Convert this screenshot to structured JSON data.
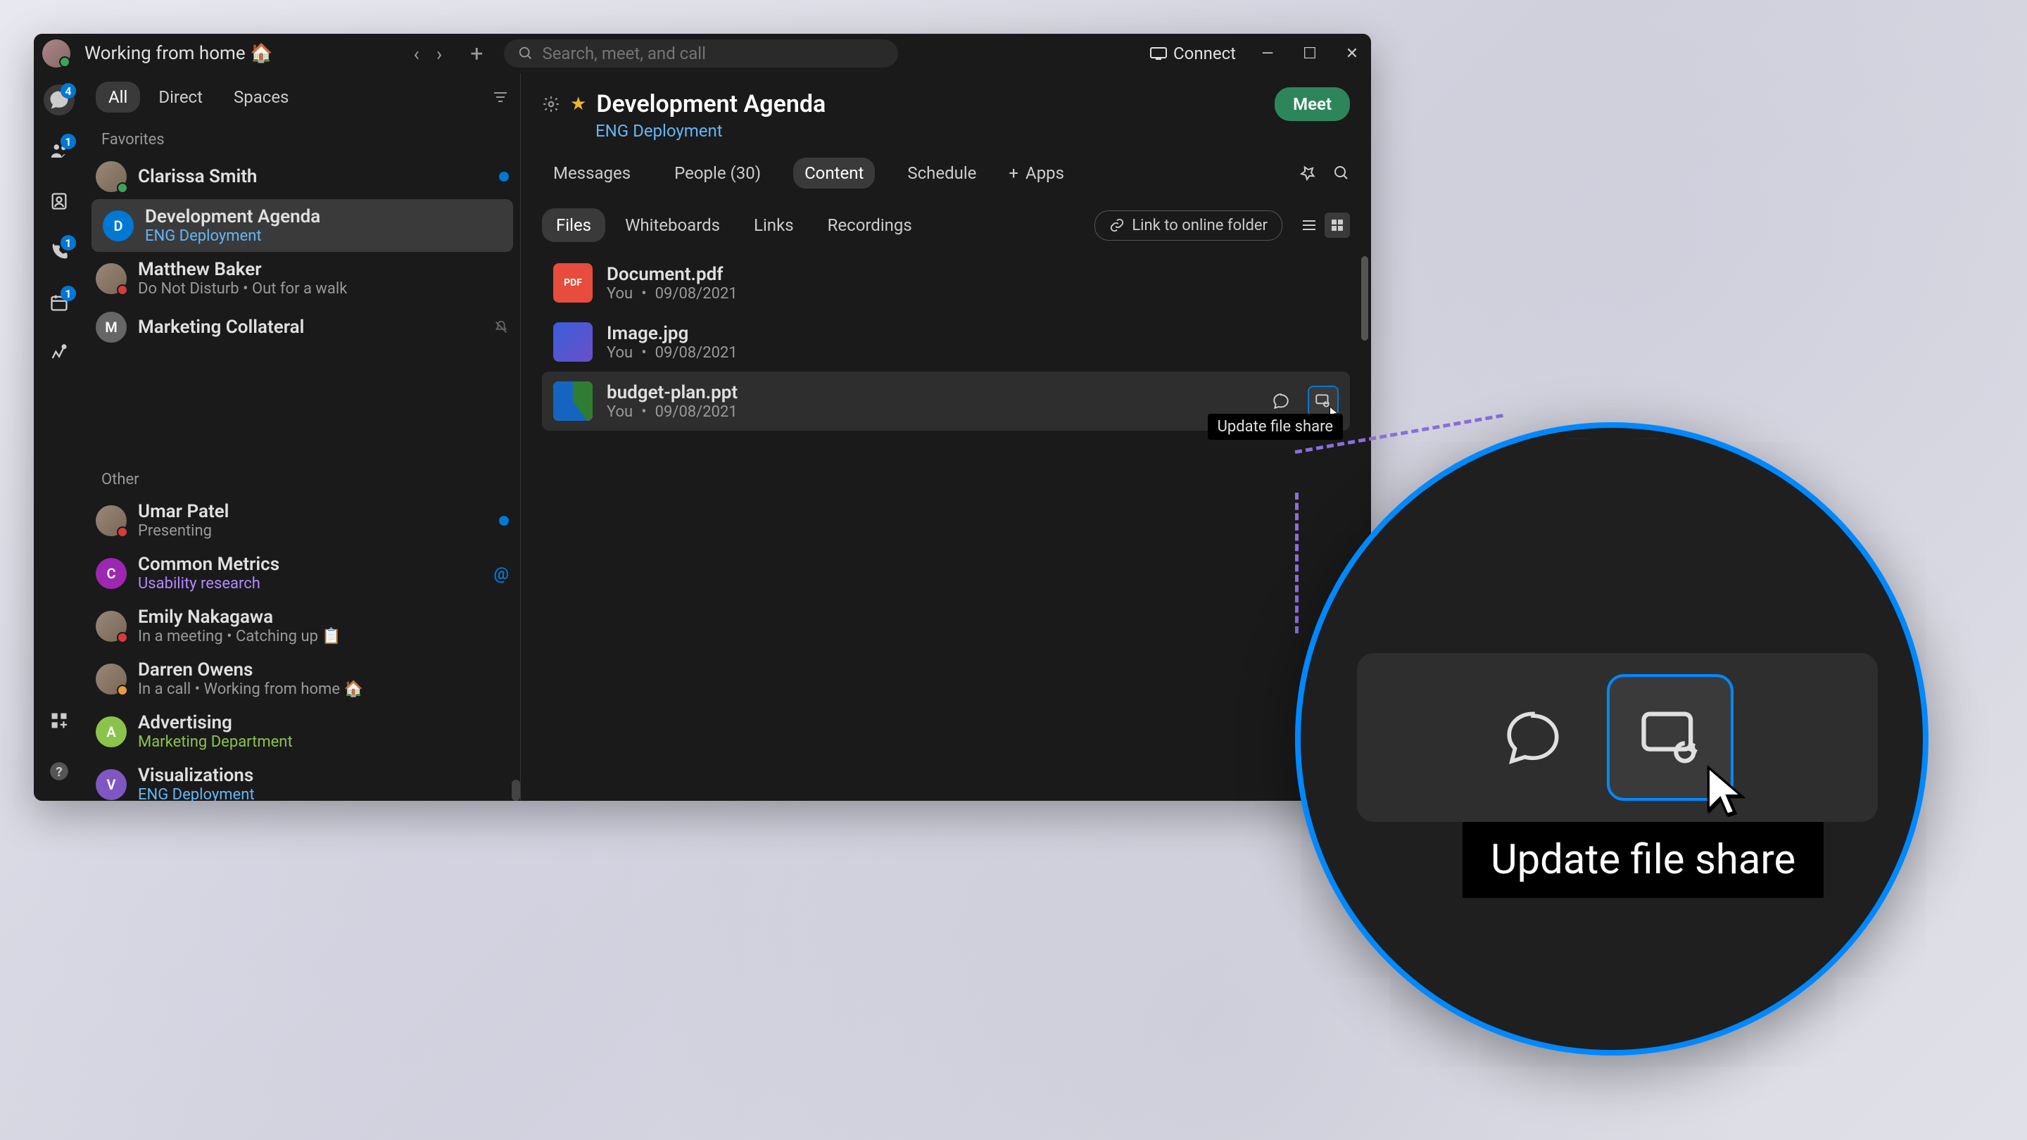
{
  "titlebar": {
    "status": "Working from home 🏠",
    "search_placeholder": "Search, meet, and call",
    "connect": "Connect"
  },
  "rail": {
    "chat_badge": "4",
    "teams_badge": "1",
    "calls_badge": "1",
    "calendar_badge": "1"
  },
  "sidebar": {
    "tabs": {
      "all": "All",
      "direct": "Direct",
      "spaces": "Spaces"
    },
    "favorites_label": "Favorites",
    "other_label": "Other",
    "favorites": [
      {
        "name": "Clarissa Smith",
        "sub": "",
        "avatar": "img",
        "unread": true,
        "presence": "green"
      },
      {
        "name": "Development Agenda",
        "sub": "ENG Deployment",
        "avatar": "D",
        "avatarColor": "#0078d4",
        "subClass": "blue",
        "selected": true
      },
      {
        "name": "Matthew Baker",
        "sub": "Do Not Disturb  •  Out for a walk",
        "avatar": "img",
        "presence": "red"
      },
      {
        "name": "Marketing Collateral",
        "sub": "",
        "avatar": "M",
        "avatarColor": "#666",
        "muted": true
      }
    ],
    "other": [
      {
        "name": "Umar Patel",
        "sub": "Presenting",
        "avatar": "img",
        "presence": "red",
        "unread": true
      },
      {
        "name": "Common Metrics",
        "sub": "Usability research",
        "avatar": "C",
        "avatarColor": "#9c27b0",
        "subClass": "purple",
        "mention": true
      },
      {
        "name": "Emily Nakagawa",
        "sub": "In a meeting  •  Catching up 📋",
        "avatar": "img",
        "presence": "red"
      },
      {
        "name": "Darren Owens",
        "sub": "In a call  •  Working from home 🏠",
        "avatar": "img",
        "presence": "orange"
      },
      {
        "name": "Advertising",
        "sub": "Marketing Department",
        "avatar": "A",
        "avatarColor": "#8bc34a",
        "subClass": "green"
      },
      {
        "name": "Visualizations",
        "sub": "ENG Deployment",
        "avatar": "V",
        "avatarColor": "#7e57c2",
        "subClass": "blue"
      }
    ]
  },
  "content": {
    "title": "Development Agenda",
    "subtitle": "ENG Deployment",
    "meet": "Meet",
    "tabs": {
      "messages": "Messages",
      "people": "People (30)",
      "content": "Content",
      "schedule": "Schedule",
      "apps": "Apps"
    },
    "subtabs": {
      "files": "Files",
      "whiteboards": "Whiteboards",
      "links": "Links",
      "recordings": "Recordings"
    },
    "link_folder": "Link to online folder",
    "files": [
      {
        "name": "Document.pdf",
        "author": "You",
        "date": "09/08/2021",
        "type": "pdf"
      },
      {
        "name": "Image.jpg",
        "author": "You",
        "date": "09/08/2021",
        "type": "img"
      },
      {
        "name": "budget-plan.ppt",
        "author": "You",
        "date": "09/08/2021",
        "type": "ppt",
        "hovered": true
      }
    ],
    "tooltip": "Update file share"
  },
  "zoom": {
    "tooltip": "Update file share"
  }
}
